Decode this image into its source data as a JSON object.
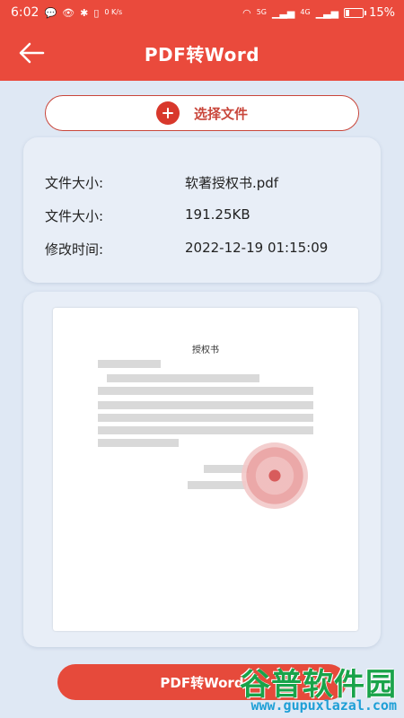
{
  "status_bar": {
    "time": "6:02",
    "left_icons": [
      "message-icon",
      "eye-icon",
      "bluetooth-icon",
      "vibrate-icon"
    ],
    "speed": "0 K/s",
    "network": [
      "wifi-icon",
      "5G",
      "4G"
    ],
    "battery": "15%"
  },
  "header": {
    "title": "PDF转Word"
  },
  "choose_file": {
    "label": "选择文件"
  },
  "file_info": {
    "rows": [
      {
        "label": "文件大小:",
        "value": "软著授权书.pdf"
      },
      {
        "label": "文件大小:",
        "value": "191.25KB"
      },
      {
        "label": "修改时间:",
        "value": "2022-12-19 01:15:09"
      }
    ]
  },
  "preview": {
    "doc_title": "授权书"
  },
  "convert": {
    "label": "PDF转Word"
  },
  "watermark": {
    "main": "谷普软件园",
    "sub": "www.gupuxlazal.com"
  },
  "colors": {
    "accent": "#ea4a3c",
    "background": "#dfe8f4",
    "watermark_green": "#19a34a",
    "watermark_blue": "#1e9fd6"
  }
}
